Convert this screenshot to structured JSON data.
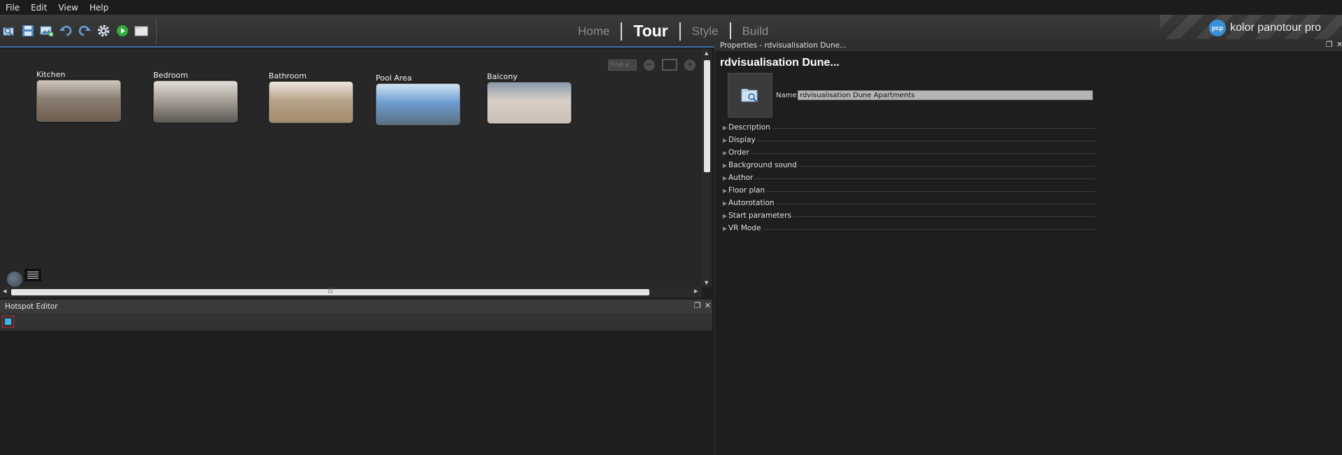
{
  "menu": [
    "File",
    "Edit",
    "View",
    "Help"
  ],
  "toolbar": {
    "icons": [
      "open-project-icon",
      "save-icon",
      "add-panorama-icon",
      "undo-icon",
      "redo-icon",
      "settings-icon",
      "preview-play-icon",
      "folder-icon"
    ]
  },
  "nav": {
    "tabs": [
      {
        "label": "Home",
        "active": false
      },
      {
        "label": "Tour",
        "active": true
      },
      {
        "label": "Style",
        "active": false
      },
      {
        "label": "Build",
        "active": false
      }
    ]
  },
  "brand": {
    "logo_text": "pcp",
    "name": "kolor panotour pro"
  },
  "tour": {
    "search_placeholder": "Find a...",
    "panoramas": [
      {
        "label": "Kitchen",
        "colors": [
          "#8a7e72",
          "#cfc7bd",
          "#6e5e4e"
        ]
      },
      {
        "label": "Bedroom",
        "colors": [
          "#a9a39b",
          "#e2ddd6",
          "#5f5a55"
        ]
      },
      {
        "label": "Bathroom",
        "colors": [
          "#b8a48a",
          "#ece6dd",
          "#a48c6b"
        ]
      },
      {
        "label": "Pool Area",
        "colors": [
          "#6f9ed2",
          "#cfe3f4",
          "#5a6f84"
        ]
      },
      {
        "label": "Balcony",
        "colors": [
          "#d9cfc7",
          "#8a9aaa",
          "#c9bfb6"
        ]
      }
    ]
  },
  "hotspot_editor": {
    "title": "Hotspot Editor"
  },
  "properties": {
    "panel_title": "Properties - rdvisualisation Dune...",
    "heading": "rdvisualisation Dune...",
    "name_label": "Name:",
    "name_value": "rdvisualisation Dune Apartments",
    "sections": [
      "Description",
      "Display",
      "Order",
      "Background sound",
      "Author",
      "Floor plan",
      "Autorotation",
      "Start parameters",
      "VR Mode"
    ]
  },
  "colors": {
    "accent": "#3b6ea8",
    "brand_logo": "#3a8fd6"
  }
}
